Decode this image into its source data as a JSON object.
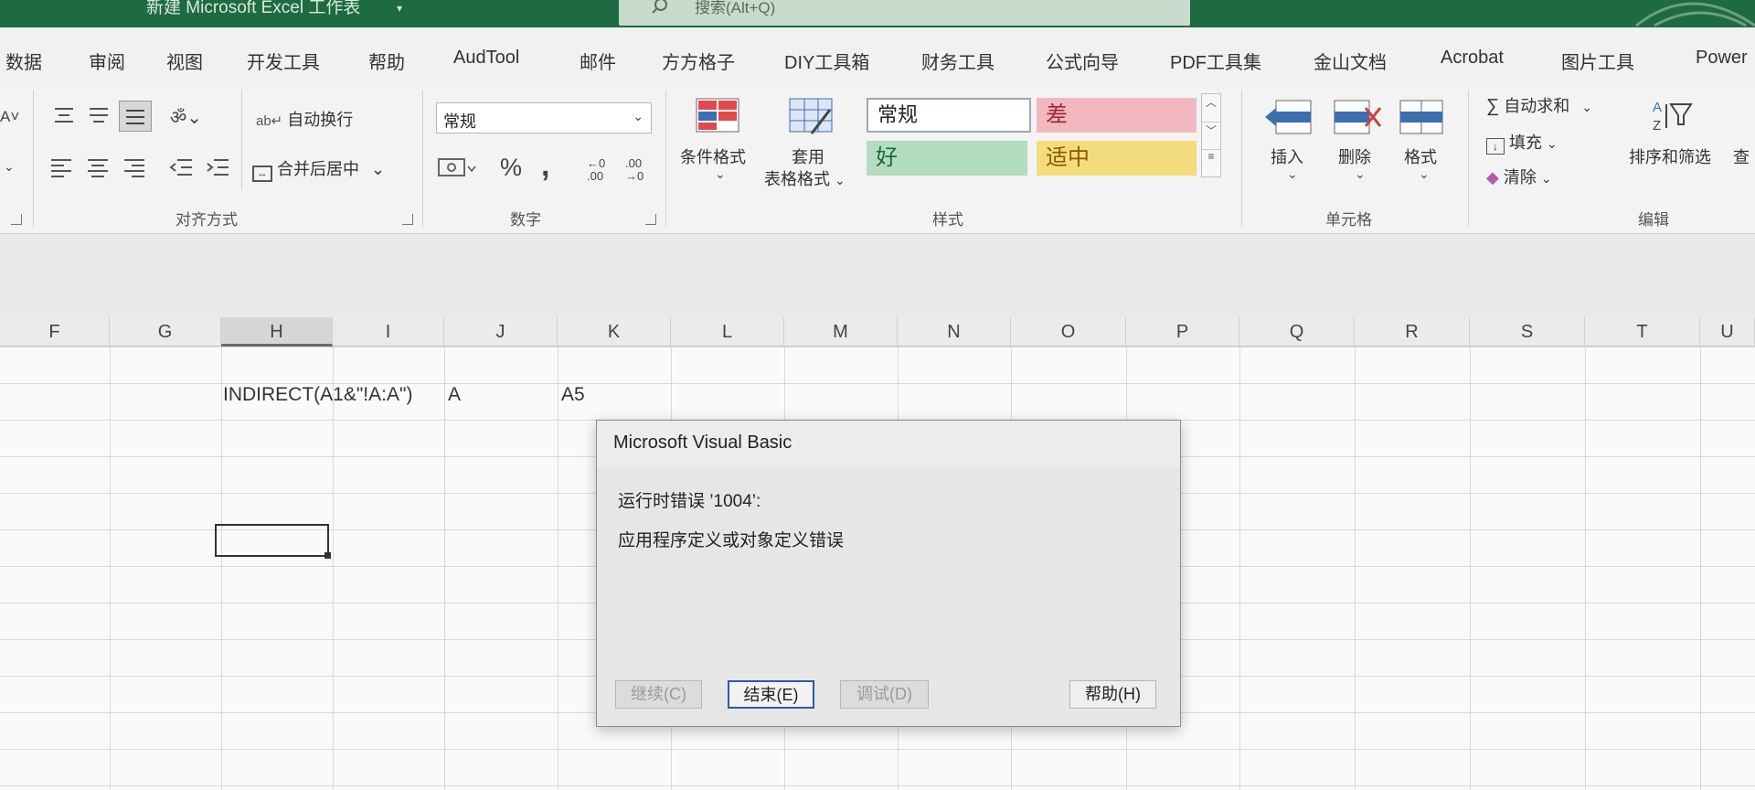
{
  "window": {
    "title": "新建 Microsoft Excel 工作表",
    "title_caret": "▾",
    "search_placeholder": "搜索(Alt+Q)"
  },
  "tabs": [
    "数据",
    "审阅",
    "视图",
    "开发工具",
    "帮助",
    "AudTool",
    "邮件",
    "方方格子",
    "DIY工具箱",
    "财务工具",
    "公式向导",
    "PDF工具集",
    "金山文档",
    "Acrobat",
    "图片工具",
    "Power"
  ],
  "ribbon": {
    "alignment": {
      "label": "对齐方式",
      "wrap_text": "自动换行",
      "merge_center": "合并后居中",
      "merge_caret": "⌄"
    },
    "number": {
      "label": "数字",
      "format_value": "常规",
      "percent": "%",
      "comma": ","
    },
    "styles": {
      "label": "样式",
      "conditional_format": "条件格式",
      "format_as_table_line1": "套用",
      "format_as_table_line2": "表格格式",
      "cell_styles": {
        "normal": "常规",
        "bad": "差",
        "good": "好",
        "neutral": "适中"
      }
    },
    "cells": {
      "label": "单元格",
      "insert": "插入",
      "delete": "删除",
      "format": "格式"
    },
    "editing": {
      "label": "编辑",
      "autosum": "自动求和",
      "fill": "填充",
      "clear": "清除",
      "sort_filter": "排序和筛选",
      "find_partial": "查"
    }
  },
  "columns": [
    "F",
    "G",
    "H",
    "I",
    "J",
    "K",
    "L",
    "M",
    "N",
    "O",
    "P",
    "Q",
    "R",
    "S",
    "T",
    "U"
  ],
  "selected_column": "H",
  "cells": {
    "H_row1": "INDIRECT(A1&\"!A:A\")",
    "J_row1": "A",
    "K_row1": "A5"
  },
  "dialog": {
    "title": "Microsoft Visual Basic",
    "message_line1": "运行时错误 ’1004’:",
    "message_line2": "应用程序定义或对象定义错误",
    "buttons": {
      "continue": "继续(C)",
      "end": "结束(E)",
      "debug": "调试(D)",
      "help": "帮助(H)"
    }
  },
  "colors": {
    "title_bar": "#1e6b41",
    "style_bad": "#f2b8c0",
    "style_good": "#b3dcc0",
    "style_neutral": "#f3dc7e",
    "focus_border": "#2d5aa8"
  }
}
